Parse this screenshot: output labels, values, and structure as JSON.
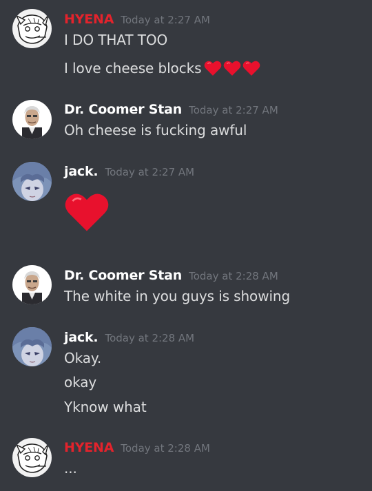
{
  "colors": {
    "background": "#36393f",
    "text": "#dcddde",
    "timestamp": "#72767d",
    "role_red": "#e3232c",
    "role_default": "#ffffff",
    "heart": "#e8112d"
  },
  "messages": [
    {
      "author": "HYENA",
      "author_color": "#e3232c",
      "avatar_icon": "hyena-sketch-avatar",
      "timestamp": "Today at 2:27 AM",
      "lines": [
        "I DO THAT TOO",
        "I love cheese blocks"
      ],
      "inline_emoji": [
        "red-heart-icon",
        "red-heart-icon",
        "red-heart-icon"
      ]
    },
    {
      "author": "Dr. Coomer Stan",
      "author_color": "#ffffff",
      "avatar_icon": "dr-coomer-avatar",
      "timestamp": "Today at 2:27 AM",
      "lines": [
        "Oh cheese is fucking awful"
      ]
    },
    {
      "author": "jack.",
      "author_color": "#ffffff",
      "avatar_icon": "jack-anime-avatar",
      "timestamp": "Today at 2:27 AM",
      "big_emoji": "red-heart-icon"
    },
    {
      "author": "Dr. Coomer Stan",
      "author_color": "#ffffff",
      "avatar_icon": "dr-coomer-avatar",
      "timestamp": "Today at 2:28 AM",
      "lines": [
        "The white in you guys is showing"
      ]
    },
    {
      "author": "jack.",
      "author_color": "#ffffff",
      "avatar_icon": "jack-anime-avatar",
      "timestamp": "Today at 2:28 AM",
      "lines": [
        "Okay.",
        "okay",
        "Yknow what"
      ]
    },
    {
      "author": "HYENA",
      "author_color": "#e3232c",
      "avatar_icon": "hyena-sketch-avatar",
      "timestamp": "Today at 2:28 AM",
      "lines": [
        "..."
      ]
    }
  ]
}
